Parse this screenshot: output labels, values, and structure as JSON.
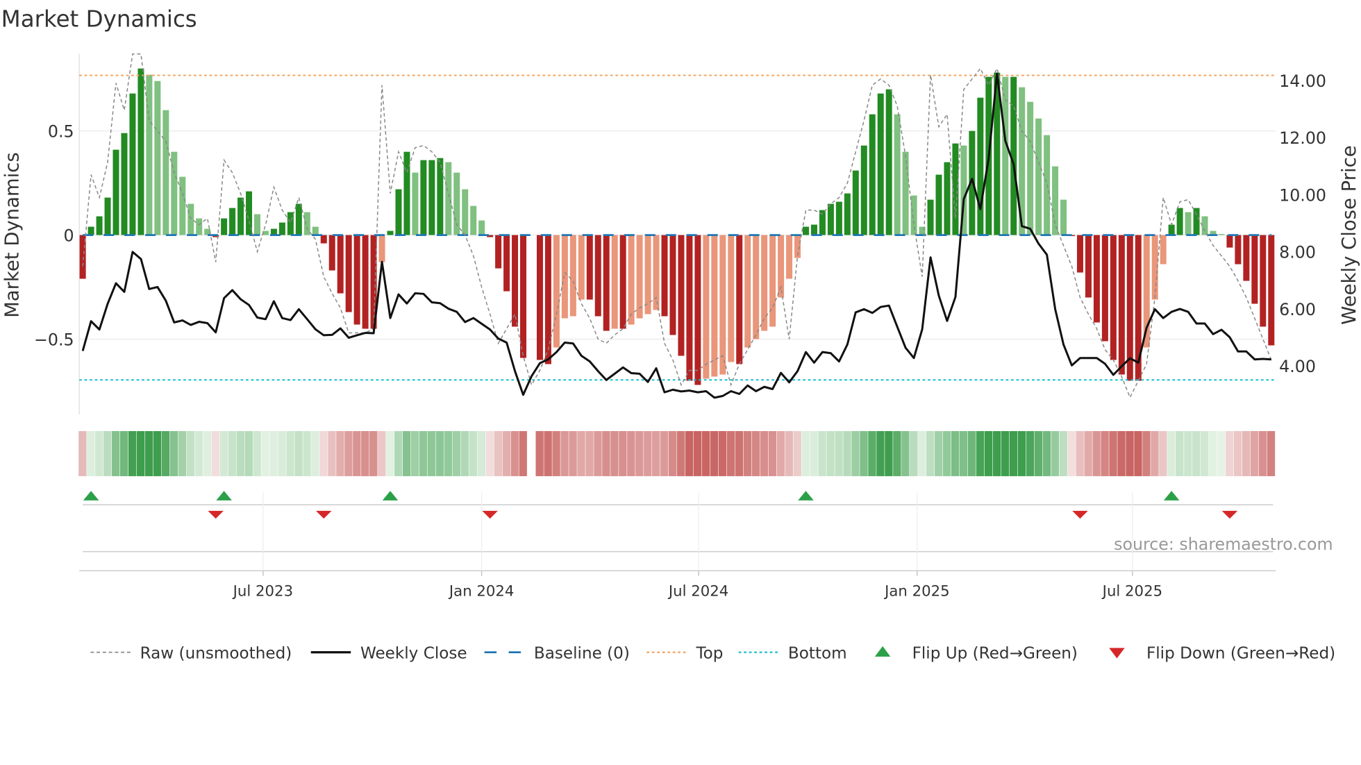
{
  "title": "Market Dynamics",
  "source": "source: sharemaestro.com",
  "colors": {
    "green_dark": "#228b22",
    "green_light": "#80c080",
    "red_dark": "#b22222",
    "red_light": "#e9967a",
    "baseline": "#1f77b4",
    "top": "#f4a460",
    "bottom": "#17becf",
    "close": "#111111",
    "raw": "#888888",
    "flip_up": "#2ca048",
    "flip_down": "#d62728"
  },
  "chart_data": {
    "type": "bar",
    "title": "Market Dynamics",
    "ylabel": "Market Dynamics",
    "y2label": "Weekly Close Price",
    "ylim": [
      -0.86,
      0.87
    ],
    "y2lim": [
      2.3,
      15.2
    ],
    "yticks": [
      {
        "v": 0.5,
        "label": "0.5"
      },
      {
        "v": 0,
        "label": "0"
      },
      {
        "v": -0.5,
        "label": "−0.5"
      }
    ],
    "y2ticks": [
      {
        "v": 14,
        "label": "14.00"
      },
      {
        "v": 12,
        "label": "12.00"
      },
      {
        "v": 10,
        "label": "10.00"
      },
      {
        "v": 8,
        "label": "8.00"
      },
      {
        "v": 6,
        "label": "6.00"
      },
      {
        "v": 4,
        "label": "4.00"
      }
    ],
    "xticks": [
      {
        "week": 21.7,
        "label": "Jul 2023"
      },
      {
        "week": 48.0,
        "label": "Jan 2024"
      },
      {
        "week": 74.1,
        "label": "Jul 2024"
      },
      {
        "week": 100.4,
        "label": "Jan 2025"
      },
      {
        "week": 126.3,
        "label": "Jul 2025"
      }
    ],
    "top": 0.767,
    "bottom": -0.696,
    "baseline": 0,
    "dynamics": [
      -0.21,
      0.04,
      0.09,
      0.18,
      0.41,
      0.49,
      0.68,
      0.8,
      0.77,
      0.74,
      0.6,
      0.4,
      0.28,
      0.15,
      0.08,
      0.03,
      -0.01,
      0.08,
      0.13,
      0.18,
      0.21,
      0.1,
      0.02,
      0.03,
      0.06,
      0.11,
      0.15,
      0.11,
      0.04,
      -0.04,
      -0.17,
      -0.28,
      -0.37,
      -0.43,
      -0.45,
      -0.45,
      -0.13,
      0.02,
      0.22,
      0.4,
      0.3,
      0.36,
      0.36,
      0.37,
      0.35,
      0.3,
      0.22,
      0.14,
      0.07,
      -0.01,
      -0.16,
      -0.27,
      -0.44,
      -0.59,
      null,
      -0.6,
      -0.62,
      -0.54,
      -0.4,
      -0.39,
      -0.31,
      -0.31,
      -0.39,
      -0.46,
      -0.45,
      -0.45,
      -0.43,
      -0.4,
      -0.38,
      -0.36,
      -0.39,
      -0.48,
      -0.58,
      -0.7,
      -0.72,
      -0.69,
      -0.68,
      -0.67,
      -0.61,
      -0.62,
      -0.54,
      -0.5,
      -0.46,
      -0.44,
      -0.3,
      -0.21,
      -0.11,
      0.04,
      0.05,
      0.12,
      0.15,
      0.16,
      0.2,
      0.31,
      0.43,
      0.58,
      0.68,
      0.7,
      0.58,
      0.4,
      0.19,
      0.04,
      0.17,
      0.29,
      0.35,
      0.44,
      0.43,
      0.5,
      0.66,
      0.76,
      0.78,
      0.76,
      0.76,
      0.71,
      0.64,
      0.56,
      0.48,
      0.33,
      0.17,
      -0.005,
      -0.18,
      -0.3,
      -0.42,
      -0.51,
      -0.6,
      -0.67,
      -0.7,
      -0.7,
      -0.54,
      -0.31,
      -0.14,
      0.05,
      0.13,
      0.11,
      0.13,
      0.09,
      0.02,
      0.005,
      -0.06,
      -0.14,
      -0.22,
      -0.33,
      -0.44,
      -0.53
    ],
    "raw": [
      -0.15,
      0.29,
      0.18,
      0.35,
      0.73,
      0.6,
      0.9,
      0.92,
      0.55,
      0.5,
      0.45,
      0.3,
      0.2,
      0.08,
      0.05,
      0.08,
      -0.13,
      0.36,
      0.3,
      0.2,
      0.07,
      -0.08,
      0.05,
      0.23,
      0.12,
      0.06,
      0.18,
      0.03,
      -0.02,
      -0.2,
      -0.28,
      -0.35,
      -0.47,
      -0.47,
      -0.47,
      -0.45,
      0.72,
      0.2,
      0.4,
      0.3,
      0.42,
      0.43,
      0.4,
      0.35,
      0.2,
      0.05,
      0.0,
      -0.1,
      -0.25,
      -0.38,
      -0.52,
      -0.45,
      -0.38,
      -0.58,
      -0.72,
      -0.65,
      -0.55,
      -0.38,
      -0.18,
      -0.22,
      -0.33,
      -0.4,
      -0.5,
      -0.52,
      -0.48,
      -0.45,
      -0.38,
      -0.35,
      -0.33,
      -0.3,
      -0.52,
      -0.6,
      -0.72,
      -0.65,
      -0.65,
      -0.62,
      -0.6,
      -0.58,
      -0.72,
      -0.62,
      -0.55,
      -0.48,
      -0.4,
      -0.35,
      -0.25,
      -0.5,
      -0.1,
      0.12,
      0.12,
      0.1,
      0.15,
      0.18,
      0.25,
      0.4,
      0.55,
      0.72,
      0.75,
      0.72,
      0.62,
      0.38,
      0.05,
      -0.2,
      0.77,
      0.52,
      0.58,
      0.08,
      0.7,
      0.75,
      0.8,
      0.72,
      0.8,
      0.65,
      0.62,
      0.5,
      0.45,
      0.35,
      0.25,
      0.05,
      -0.05,
      -0.15,
      -0.3,
      -0.38,
      -0.45,
      -0.55,
      -0.6,
      -0.68,
      -0.78,
      -0.7,
      -0.62,
      -0.3,
      0.18,
      0.05,
      0.16,
      0.17,
      0.1,
      0.02,
      -0.05,
      -0.1,
      -0.15,
      -0.22,
      -0.3,
      -0.4,
      -0.5,
      -0.6
    ],
    "close": [
      4.53,
      5.57,
      5.28,
      6.18,
      6.9,
      6.6,
      8.0,
      7.75,
      6.7,
      6.77,
      6.29,
      5.53,
      5.6,
      5.44,
      5.55,
      5.5,
      5.18,
      6.38,
      6.66,
      6.34,
      6.14,
      5.7,
      5.64,
      6.27,
      5.68,
      5.61,
      5.99,
      5.64,
      5.29,
      5.08,
      5.09,
      5.32,
      4.99,
      5.08,
      5.16,
      5.15,
      7.65,
      5.68,
      6.51,
      6.19,
      6.55,
      6.53,
      6.23,
      6.2,
      6.01,
      5.9,
      5.54,
      5.68,
      5.48,
      5.28,
      4.96,
      4.82,
      3.82,
      2.99,
      3.64,
      4.1,
      4.23,
      4.49,
      4.82,
      4.79,
      4.36,
      4.16,
      3.82,
      3.51,
      3.73,
      3.95,
      3.75,
      3.73,
      3.44,
      3.92,
      3.08,
      3.17,
      3.11,
      3.14,
      3.08,
      3.12,
      2.89,
      2.95,
      3.12,
      3.02,
      3.32,
      3.12,
      3.27,
      3.19,
      3.76,
      3.43,
      3.82,
      4.49,
      4.12,
      4.49,
      4.45,
      4.16,
      4.76,
      5.88,
      5.99,
      5.86,
      6.07,
      6.12,
      5.38,
      4.64,
      4.28,
      5.29,
      7.81,
      6.47,
      5.58,
      6.42,
      9.85,
      10.56,
      9.5,
      11.28,
      14.25,
      11.89,
      11.07,
      8.9,
      8.81,
      8.29,
      7.9,
      5.99,
      4.76,
      4.02,
      4.28,
      4.28,
      4.28,
      4.08,
      3.69,
      3.99,
      4.27,
      4.12,
      5.34,
      5.99,
      5.68,
      5.9,
      6.0,
      5.9,
      5.49,
      5.49,
      5.12,
      5.27,
      5.01,
      4.51,
      4.51,
      4.23,
      4.25,
      4.23
    ],
    "flip_up_weeks": [
      1,
      17,
      37,
      87,
      131
    ],
    "flip_down_weeks": [
      16,
      29,
      49,
      120,
      138
    ],
    "legend": {
      "placement": "bottom",
      "items": [
        {
          "key": "raw",
          "label": "Raw (unsmoothed)"
        },
        {
          "key": "close",
          "label": "Weekly Close"
        },
        {
          "key": "baseline",
          "label": "Baseline (0)"
        },
        {
          "key": "top",
          "label": "Top"
        },
        {
          "key": "bottom",
          "label": "Bottom"
        },
        {
          "key": "flip_up",
          "label": "Flip Up (Red→Green)"
        },
        {
          "key": "flip_down",
          "label": "Flip Down (Green→Red)"
        }
      ]
    }
  }
}
